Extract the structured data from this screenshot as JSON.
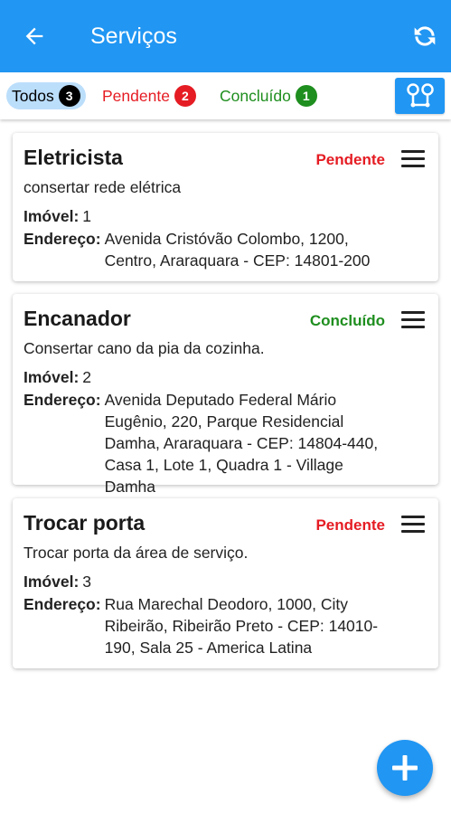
{
  "appbar": {
    "title": "Serviços",
    "back_icon": "arrow-left-icon",
    "refresh_icon": "refresh-icon"
  },
  "filters": {
    "todos": {
      "label": "Todos",
      "count": "3"
    },
    "pendente": {
      "label": "Pendente",
      "count": "2"
    },
    "concluido": {
      "label": "Concluído",
      "count": "1"
    },
    "map_icon": "route-map-icon"
  },
  "labels": {
    "imovel": "Imóvel:",
    "endereco": "Endereço:"
  },
  "services": [
    {
      "name": "Eletricista",
      "status": "Pendente",
      "description": "consertar rede elétrica",
      "imovel": "1",
      "endereco": "Avenida Cristóvão Colombo, 1200, Centro, Araraquara - CEP: 14801-200"
    },
    {
      "name": "Encanador",
      "status": "Concluído",
      "description": "Consertar cano da pia da cozinha.",
      "imovel": "2",
      "endereco": "Avenida Deputado Federal Mário Eugênio, 220, Parque Residencial Damha, Araraquara - CEP: 14804-440, Casa 1, Lote 1, Quadra 1 - Village Damha"
    },
    {
      "name": "Trocar porta",
      "status": "Pendente",
      "description": "Trocar porta da área de serviço.",
      "imovel": "3",
      "endereco": "Rua Marechal Deodoro, 1000, City Ribeirão, Ribeirão Preto - CEP: 14010-190, Sala 25 - America Latina"
    }
  ],
  "colors": {
    "primary": "#2196f3",
    "pending": "#e51c23",
    "done": "#1e8e1e",
    "selected_chip": "#bbdefb"
  },
  "fab": {
    "icon": "plus-icon"
  }
}
